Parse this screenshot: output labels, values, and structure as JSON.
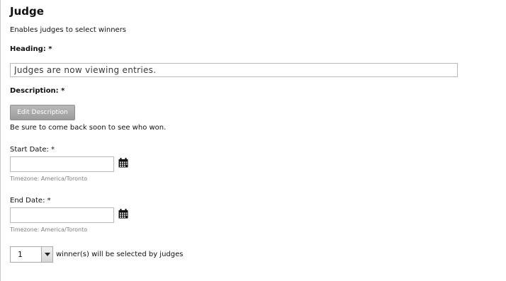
{
  "section": {
    "title": "Judge",
    "subtitle": "Enables judges to select winners"
  },
  "heading": {
    "label": "Heading: *",
    "value": "Judges are now viewing entries."
  },
  "description": {
    "label": "Description: *",
    "edit_button": "Edit Description",
    "text": "Be sure to come back soon to see who won."
  },
  "start_date": {
    "label": "Start Date: *",
    "value": "",
    "icon": "calendar-icon",
    "timezone": "Timezone: America/Toronto"
  },
  "end_date": {
    "label": "End Date: *",
    "value": "",
    "icon": "calendar-icon",
    "timezone": "Timezone: America/Toronto"
  },
  "winners": {
    "selected": "1",
    "text": "winner(s) will be selected by judges"
  },
  "colors": {
    "button_bg": "#a9a9a9",
    "border": "#b9b9b9",
    "muted_text": "#808080"
  }
}
